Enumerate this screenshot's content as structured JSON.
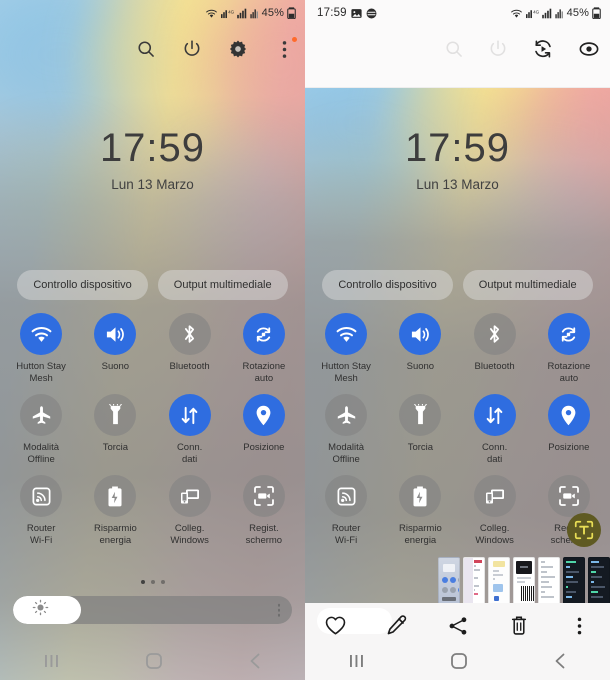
{
  "left_panel": {
    "status_bar": {
      "icons": [
        "wifi-icon",
        "signal-data-icon",
        "signal-bars-icon",
        "signal-alt-icon"
      ],
      "battery_percent": "45%",
      "battery_icon": "battery-charging-icon"
    },
    "top_actions": [
      {
        "name": "search-icon",
        "label": "Cerca"
      },
      {
        "name": "power-icon",
        "label": "Spegnimento"
      },
      {
        "name": "gear-icon",
        "label": "Impostazioni"
      },
      {
        "name": "more-options-icon",
        "label": "Altre opzioni",
        "badge": true
      }
    ],
    "clock": {
      "time": "17:59",
      "date": "Lun 13 Marzo"
    },
    "pills": [
      {
        "label": "Controllo dispositivo"
      },
      {
        "label": "Output multimediale"
      }
    ],
    "toggles": [
      {
        "label": "Hutton Stay\nMesh",
        "icon": "wifi-icon",
        "state": "on"
      },
      {
        "label": "Suono",
        "icon": "volume-icon",
        "state": "on"
      },
      {
        "label": "Bluetooth",
        "icon": "bluetooth-icon",
        "state": "off"
      },
      {
        "label": "Rotazione\nauto",
        "icon": "auto-rotate-icon",
        "state": "on"
      },
      {
        "label": "Modalità\nOffline",
        "icon": "airplane-icon",
        "state": "off"
      },
      {
        "label": "Torcia",
        "icon": "flashlight-icon",
        "state": "off"
      },
      {
        "label": "Conn.\ndati",
        "icon": "mobile-data-icon",
        "state": "on"
      },
      {
        "label": "Posizione",
        "icon": "location-pin-icon",
        "state": "on"
      },
      {
        "label": "Router\nWi-Fi",
        "icon": "hotspot-icon",
        "state": "off"
      },
      {
        "label": "Risparmio\nenergia",
        "icon": "power-saving-icon",
        "state": "off"
      },
      {
        "label": "Colleg. Windows",
        "icon": "link-to-windows-icon",
        "state": "off"
      },
      {
        "label": "Regist. schermo",
        "icon": "screen-record-icon",
        "state": "off"
      }
    ],
    "page_dots": {
      "count": 3,
      "active_index": 0
    },
    "brightness": {
      "icon": "brightness-sun-icon",
      "level_percent": 21,
      "menu_icon": "more-vertical-icon"
    },
    "nav_bar": [
      {
        "name": "recents-icon"
      },
      {
        "name": "home-icon"
      },
      {
        "name": "back-icon"
      }
    ]
  },
  "right_panel": {
    "status_bar": {
      "time": "17:59",
      "left_icons": [
        "image-icon",
        "app-circle-icon"
      ],
      "icons": [
        "wifi-icon",
        "signal-data-icon",
        "signal-bars-icon",
        "signal-alt-icon"
      ],
      "battery_percent": "45%",
      "battery_icon": "battery-charging-icon"
    },
    "ghost_actions": [
      {
        "name": "search-icon"
      },
      {
        "name": "power-icon"
      }
    ],
    "screenshot_actions": [
      {
        "name": "scroll-capture-icon",
        "label": "Cattura con scorrimento"
      },
      {
        "name": "eye-preview-icon",
        "label": "Anteprima"
      }
    ],
    "clock": {
      "time": "17:59",
      "date": "Lun 13 Marzo"
    },
    "pills": [
      {
        "label": "Controllo dispositivo"
      },
      {
        "label": "Output multimediale"
      }
    ],
    "toggles": [
      {
        "label": "Hutton Stay\nMesh",
        "icon": "wifi-icon",
        "state": "on"
      },
      {
        "label": "Suono",
        "icon": "volume-icon",
        "state": "on"
      },
      {
        "label": "Bluetooth",
        "icon": "bluetooth-icon",
        "state": "off"
      },
      {
        "label": "Rotazione\nauto",
        "icon": "auto-rotate-icon",
        "state": "on"
      },
      {
        "label": "Modalità\nOffline",
        "icon": "airplane-icon",
        "state": "off"
      },
      {
        "label": "Torcia",
        "icon": "flashlight-icon",
        "state": "off"
      },
      {
        "label": "Conn.\ndati",
        "icon": "mobile-data-icon",
        "state": "on"
      },
      {
        "label": "Posizione",
        "icon": "location-pin-icon",
        "state": "on"
      },
      {
        "label": "Router\nWi-Fi",
        "icon": "hotspot-icon",
        "state": "off"
      },
      {
        "label": "Risparmio\nenergia",
        "icon": "power-saving-icon",
        "state": "off"
      },
      {
        "label": "Colleg. Windows",
        "icon": "link-to-windows-icon",
        "state": "off"
      },
      {
        "label": "Regist. schermo",
        "icon": "screen-record-icon",
        "state": "off"
      }
    ],
    "text_extract_fab": {
      "name": "text-extract-icon",
      "color": "#5f5a22"
    },
    "thumbnail_count": 7,
    "toolbar": [
      {
        "name": "favorite-icon",
        "label": "Preferiti",
        "highlighted": true
      },
      {
        "name": "edit-pencil-icon",
        "label": "Modifica"
      },
      {
        "name": "share-icon",
        "label": "Condividi"
      },
      {
        "name": "delete-trash-icon",
        "label": "Elimina"
      },
      {
        "name": "more-options-icon",
        "label": "Altro"
      }
    ],
    "nav_bar": [
      {
        "name": "recents-icon"
      },
      {
        "name": "home-icon"
      },
      {
        "name": "back-icon"
      }
    ]
  },
  "colors": {
    "accent_on": "#2f6de0",
    "toggle_off": "rgba(130,130,130,.62)",
    "fab": "#5f5a22",
    "badge": "#ff6a2b"
  }
}
